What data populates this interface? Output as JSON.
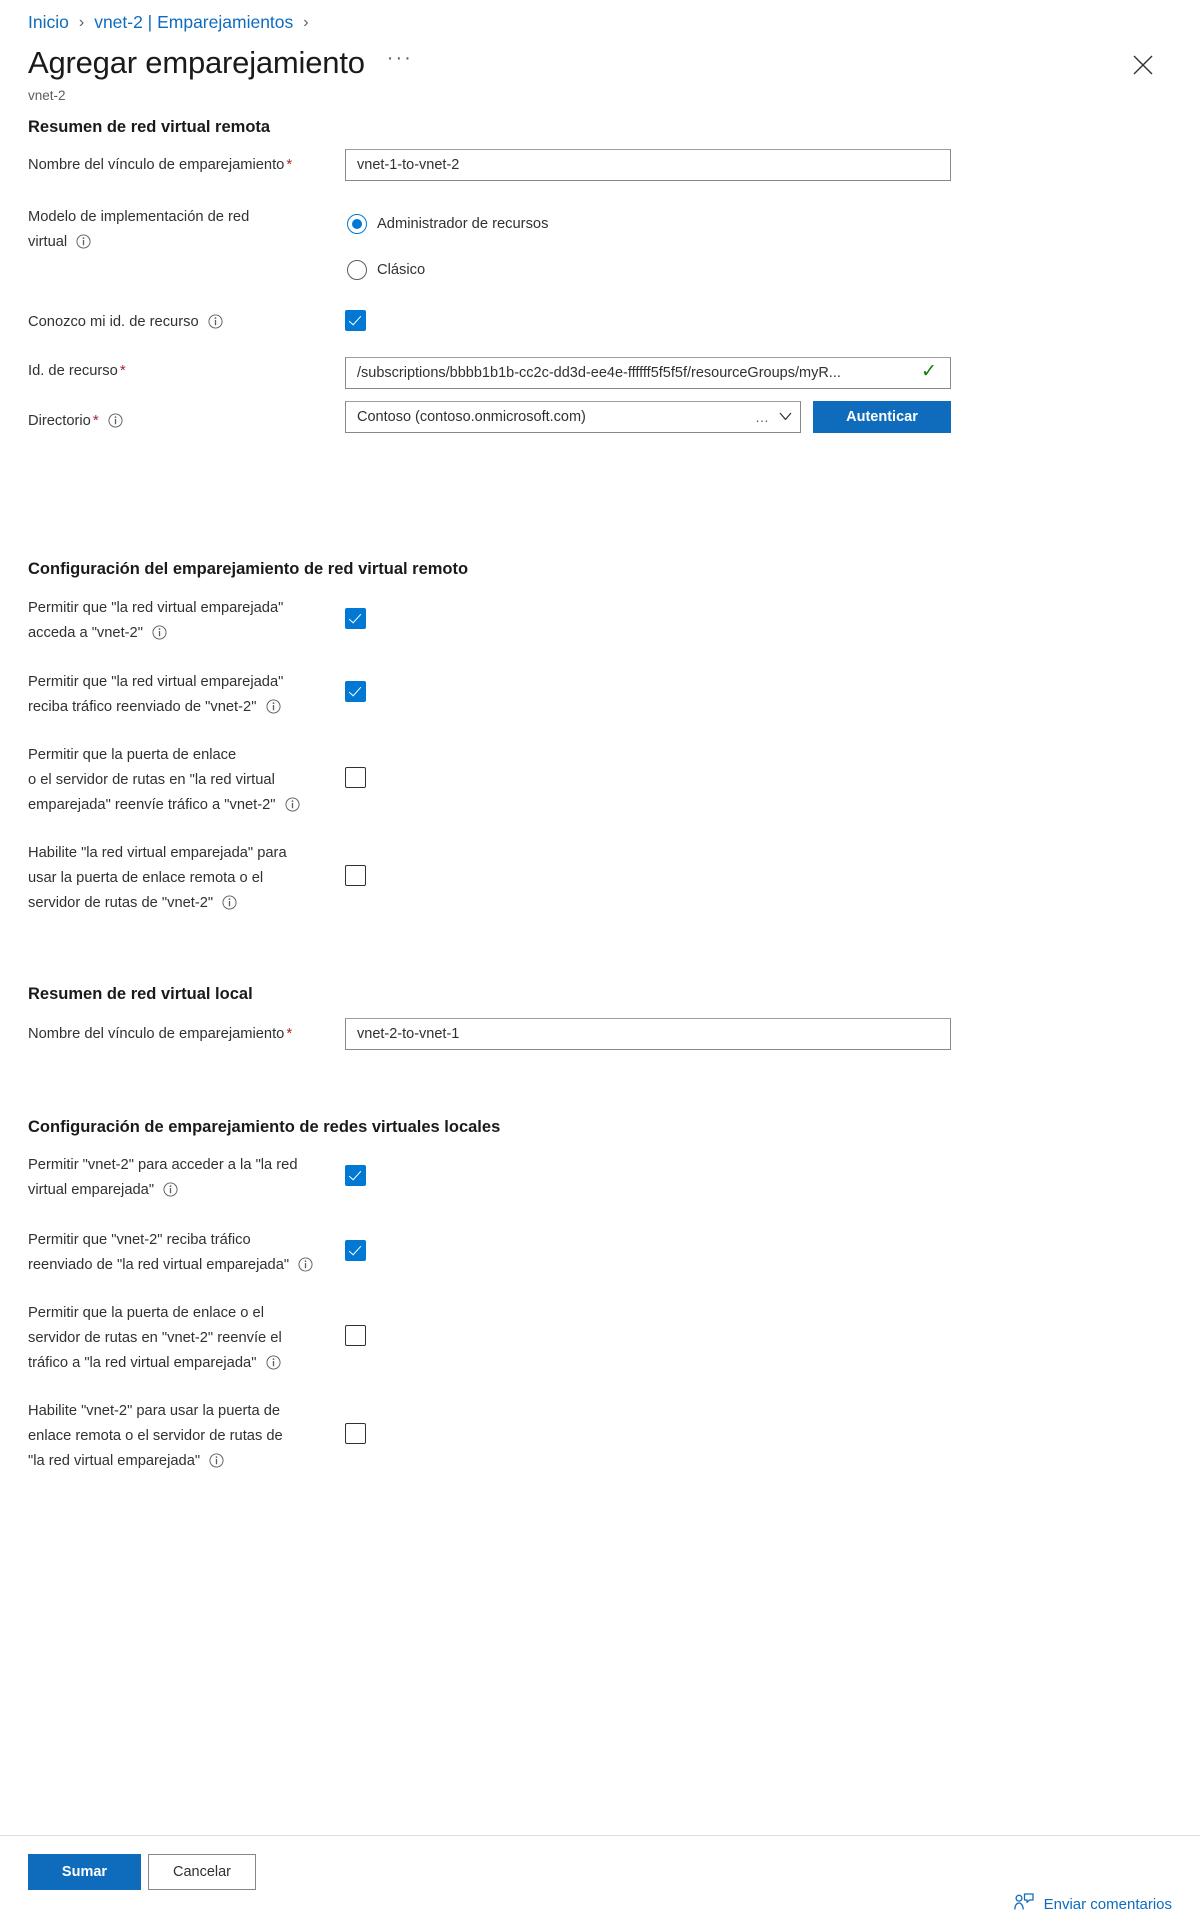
{
  "breadcrumb": {
    "items": [
      "Inicio",
      "vnet-2 | Emparejamientos"
    ],
    "separator": "›"
  },
  "header": {
    "title": "Agregar emparejamiento",
    "subtitle": "vnet-2",
    "ellipsis": "···",
    "close_icon": "close-icon"
  },
  "remote_summary": {
    "heading": "Resumen de red virtual remota",
    "peering_link_name": {
      "label": "Nombre del vínculo de emparejamiento",
      "required": "*",
      "value": "vnet-1-to-vnet-2"
    },
    "deployment_model": {
      "label_line1": "Modelo de implementación de red",
      "label_line2": "virtual",
      "options": [
        {
          "label": "Administrador de recursos",
          "selected": true
        },
        {
          "label": "Clásico",
          "selected": false
        }
      ]
    },
    "know_resource_id": {
      "label": "Conozco mi id. de recurso",
      "checked": true
    },
    "resource_id": {
      "label": "Id. de recurso",
      "required": "*",
      "value": "/subscriptions/bbbb1b1b-cc2c-dd3d-ee4e-ffffff5f5f5f/resourceGroups/myR...",
      "valid_icon": "✓"
    },
    "directory": {
      "label": "Directorio",
      "required": "*",
      "value": "Contoso (contoso.onmicrosoft.com)",
      "dots": "…",
      "chevron": "∨",
      "authenticate_button": "Autenticar"
    }
  },
  "remote_config": {
    "heading": "Configuración del emparejamiento de red virtual remoto",
    "checkboxes": [
      {
        "lines": [
          "Permitir que \"la red virtual emparejada\"",
          "acceda a \"vnet-2\""
        ],
        "checked": true
      },
      {
        "lines": [
          "Permitir que \"la red virtual emparejada\"",
          "reciba tráfico reenviado de \"vnet-2\""
        ],
        "checked": true
      },
      {
        "lines": [
          "Permitir que la puerta de enlace",
          "o el servidor de rutas en \"la red virtual",
          "emparejada\" reenvíe tráfico a \"vnet-2\""
        ],
        "checked": false
      },
      {
        "lines": [
          "Habilite \"la red virtual emparejada\" para",
          "usar la puerta de enlace remota o el",
          "servidor de rutas de \"vnet-2\""
        ],
        "checked": false
      }
    ]
  },
  "local_summary": {
    "heading": "Resumen de red virtual local",
    "peering_link_name": {
      "label": "Nombre del vínculo de emparejamiento",
      "required": "*",
      "value": "vnet-2-to-vnet-1"
    }
  },
  "local_config": {
    "heading": "Configuración de emparejamiento de redes virtuales locales",
    "checkboxes": [
      {
        "lines": [
          "Permitir \"vnet-2\" para acceder a la \"la red",
          "virtual emparejada\""
        ],
        "checked": true
      },
      {
        "lines": [
          "Permitir que \"vnet-2\" reciba tráfico",
          "reenviado de \"la red virtual emparejada\""
        ],
        "checked": true
      },
      {
        "lines": [
          "Permitir que la puerta de enlace o el",
          "servidor de rutas en \"vnet-2\" reenvíe el",
          "tráfico a \"la red virtual emparejada\""
        ],
        "checked": false
      },
      {
        "lines": [
          "Habilite \"vnet-2\" para usar la puerta de",
          "enlace remota o el servidor de rutas de",
          "\"la red virtual emparejada\""
        ],
        "checked": false
      }
    ]
  },
  "footer": {
    "add_label": "Sumar",
    "cancel_label": "Cancelar",
    "feedback_label": "Enviar comentarios",
    "feedback_icon": "person-feedback-icon"
  },
  "colors": {
    "accent": "#0f6cbd",
    "link": "#0078d4",
    "required": "#a4262c",
    "success": "#107c10"
  }
}
